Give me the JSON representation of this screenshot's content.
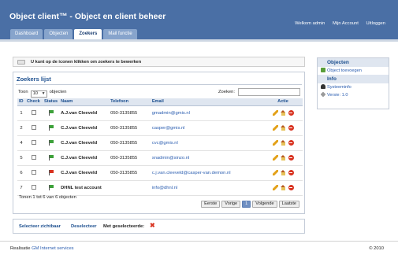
{
  "header": {
    "title": "Object client™ - Object en client beheer",
    "links": [
      "Welkom admin",
      "Mijn Account",
      "Uitloggen"
    ]
  },
  "tabs": [
    {
      "label": "Dashboard",
      "active": false
    },
    {
      "label": "Objecten",
      "active": false
    },
    {
      "label": "Zoekers",
      "active": true
    },
    {
      "label": "Mail functie",
      "active": false
    }
  ],
  "notice": {
    "text": "U kunt op de iconen klikken om zoekers te bewerken"
  },
  "panel": {
    "title": "Zoekers lijst",
    "show_prefix": "Toon",
    "show_value": "10",
    "show_suffix": "objecten",
    "search_label": "Zoeken:",
    "search_value": ""
  },
  "table": {
    "headers": [
      "ID",
      "Check",
      "Status",
      "Naam",
      "Telefoon",
      "Email",
      "Actie"
    ],
    "rows": [
      {
        "id": "1",
        "status_color": "#3da13a",
        "name": "A.J.van Cleeveld",
        "phone": "050-3135855",
        "email": "gmadmin@gmis.nl"
      },
      {
        "id": "2",
        "status_color": "#3da13a",
        "name": "C.J.van Cleeveld",
        "phone": "050-3135855",
        "email": "casper@gmis.nl"
      },
      {
        "id": "4",
        "status_color": "#3da13a",
        "name": "C.J.van Cleeveld",
        "phone": "050-3135855",
        "email": "cvc@gmis.nl"
      },
      {
        "id": "5",
        "status_color": "#3da13a",
        "name": "C.J.van Cleeveld",
        "phone": "050-3135855",
        "email": "snadmin@sinzo.nl"
      },
      {
        "id": "6",
        "status_color": "#d8321f",
        "name": "C.J.van Cleeveld",
        "phone": "050-3135855",
        "email": "c.j.van.cleeveld@casper-van.demon.nl"
      },
      {
        "id": "7",
        "status_color": "#3da13a",
        "name": "DHNL test account",
        "phone": "",
        "email": "info@dhnl.nl"
      }
    ]
  },
  "summary": "Tonen 1 tot 6 van 6 objecten",
  "pager": {
    "first": "Eerste",
    "prev": "Vorige",
    "current": "1",
    "next": "Volgende",
    "last": "Laatste"
  },
  "bulk": {
    "select_visible": "Selecteer zichtbaar",
    "deselect": "Deselecteer",
    "with_selected": "Met geselecteerde:"
  },
  "sidebar": {
    "objects_head": "Objecten",
    "add_object": "Object toevoegen",
    "info_head": "Info",
    "system_info": "Systeeminfo",
    "version": "Versie: 1.0"
  },
  "footer": {
    "made_by": "Realisatie",
    "company": "GM Internet services",
    "copyright": "© 2010"
  }
}
